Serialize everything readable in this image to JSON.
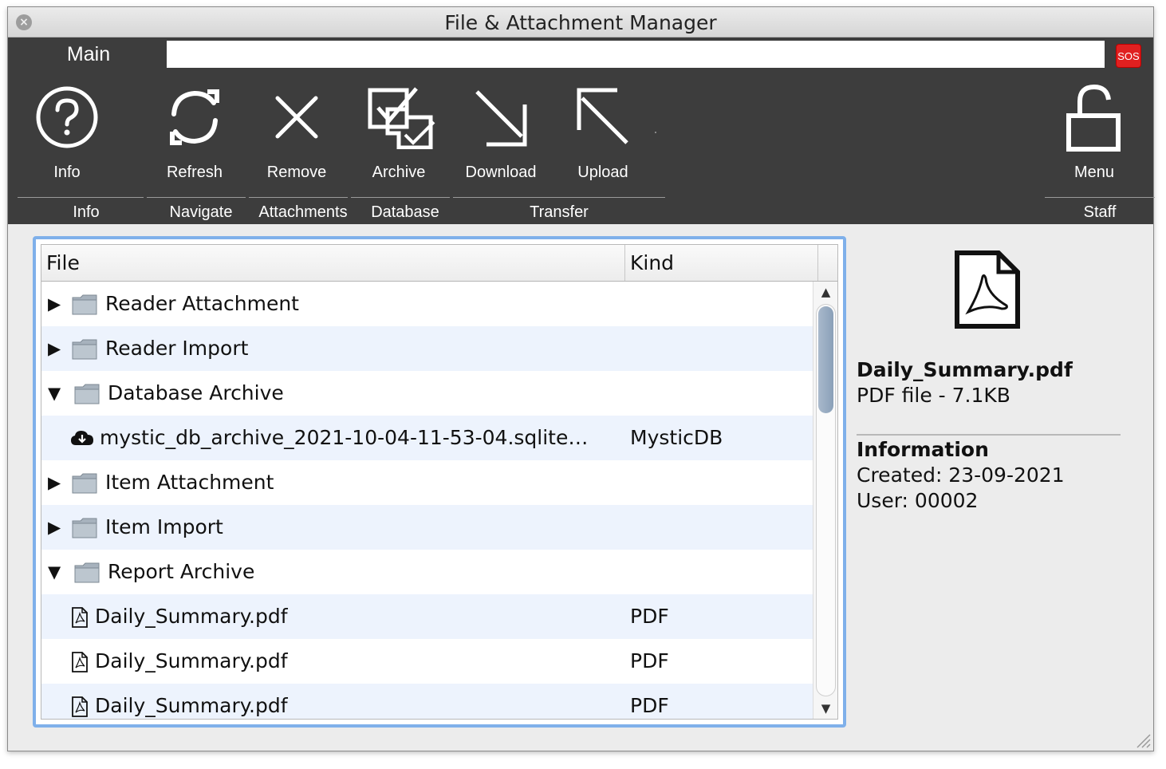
{
  "window": {
    "title": "File & Attachment Manager"
  },
  "tabs": {
    "main": "Main",
    "sos": "SOS"
  },
  "toolbar": {
    "buttons": [
      {
        "label": "Info",
        "icon": "question-circle-icon"
      },
      {
        "label": "Refresh",
        "icon": "refresh-icon"
      },
      {
        "label": "Remove",
        "icon": "x-icon"
      },
      {
        "label": "Archive",
        "icon": "archive-check-icon"
      },
      {
        "label": "Download",
        "icon": "arrow-down-right-icon"
      },
      {
        "label": "Upload",
        "icon": "arrow-up-left-icon"
      },
      {
        "label": "Menu",
        "icon": "unlock-icon"
      }
    ],
    "groups": [
      "Info",
      "Navigate",
      "Attachments",
      "Database",
      "Transfer",
      "Staff"
    ]
  },
  "tree": {
    "columns": {
      "file": "File",
      "kind": "Kind"
    },
    "rows": [
      {
        "expanded": false,
        "type": "folder",
        "name": "Reader Attachment",
        "kind": ""
      },
      {
        "expanded": false,
        "type": "folder",
        "name": "Reader Import",
        "kind": ""
      },
      {
        "expanded": true,
        "type": "folder",
        "name": "Database Archive",
        "kind": ""
      },
      {
        "type": "cloud-file",
        "name": "mystic_db_archive_2021-10-04-11-53-04.sqlite…",
        "kind": "MysticDB"
      },
      {
        "expanded": false,
        "type": "folder",
        "name": "Item Attachment",
        "kind": ""
      },
      {
        "expanded": false,
        "type": "folder",
        "name": "Item Import",
        "kind": ""
      },
      {
        "expanded": true,
        "type": "folder",
        "name": "Report Archive",
        "kind": ""
      },
      {
        "type": "pdf",
        "name": "Daily_Summary.pdf",
        "kind": "PDF"
      },
      {
        "type": "pdf",
        "name": "Daily_Summary.pdf",
        "kind": "PDF"
      },
      {
        "type": "pdf",
        "name": "Daily_Summary.pdf",
        "kind": "PDF"
      }
    ]
  },
  "detail": {
    "filename": "Daily_Summary.pdf",
    "meta": "PDF file - 7.1KB",
    "info_heading": "Information",
    "created": "Created: 23-09-2021",
    "user": "User: 00002"
  },
  "colors": {
    "toolbar_bg": "#3d3d3d",
    "selection_border": "#7fb0ea",
    "alt_row": "#edf3fd",
    "sos": "#e02020"
  }
}
